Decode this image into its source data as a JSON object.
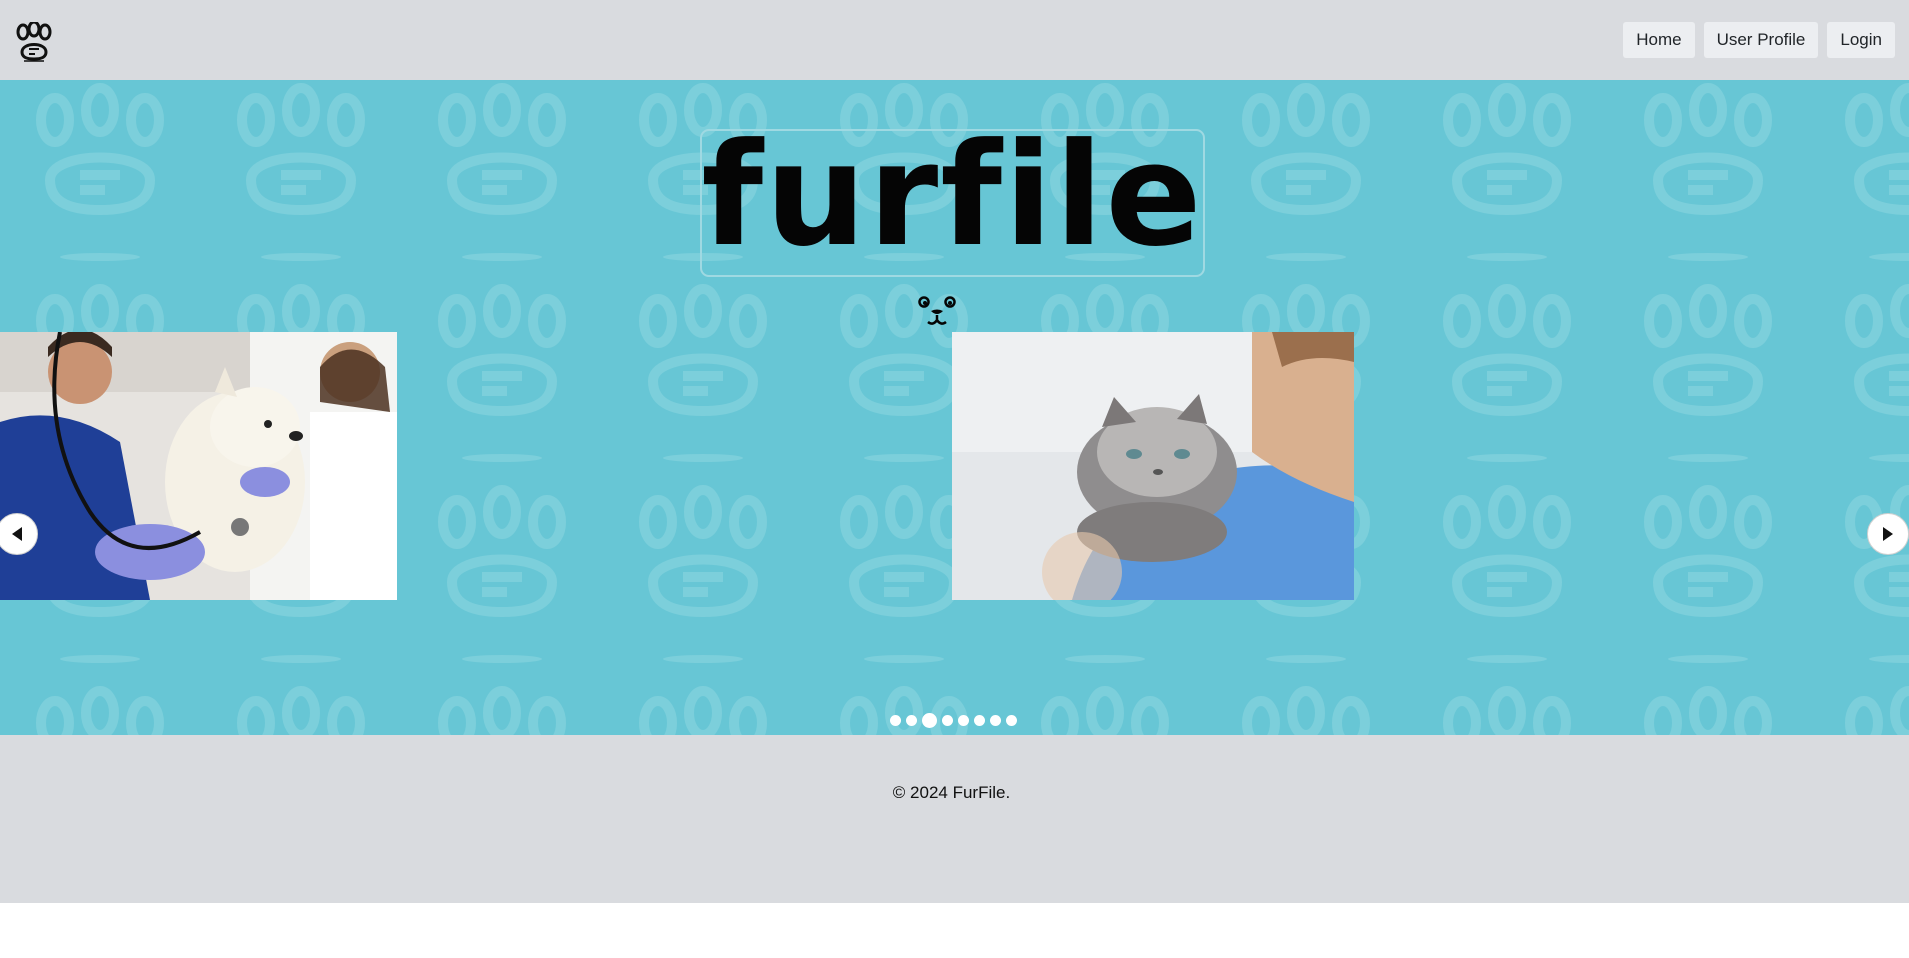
{
  "header": {
    "logo_icon": "paw-icon",
    "nav": [
      {
        "label": "Home"
      },
      {
        "label": "User Profile"
      },
      {
        "label": "Login"
      }
    ]
  },
  "hero": {
    "brand": "furfile",
    "background_color": "#67c6d5",
    "carousel": {
      "slides": [
        {
          "alt": "vet-with-dog-image"
        },
        {
          "alt": "vet-with-cat-image"
        }
      ],
      "prev_icon": "chevron-left-icon",
      "next_icon": "chevron-right-icon",
      "dot_count": 8,
      "active_dot": 3
    }
  },
  "footer": {
    "text": "© 2024 FurFile."
  }
}
